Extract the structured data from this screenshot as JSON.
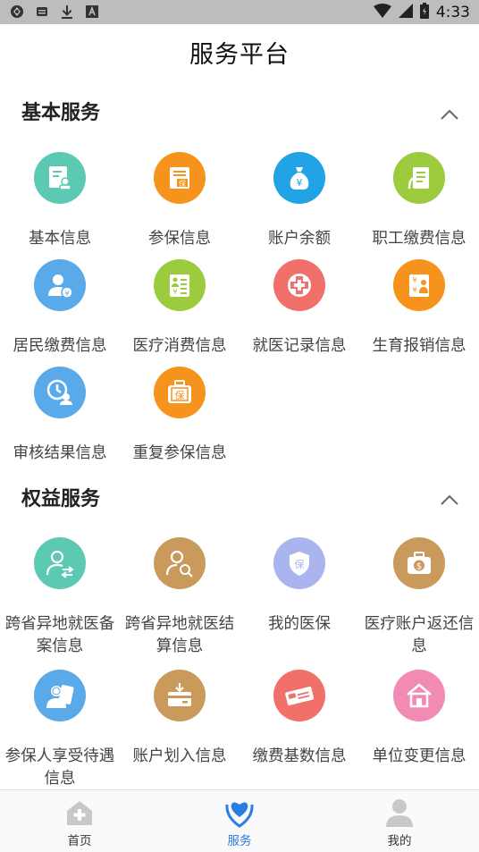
{
  "status_bar": {
    "time": "4:33"
  },
  "header": {
    "title": "服务平台"
  },
  "sections": [
    {
      "title": "基本服务",
      "items": [
        {
          "label": "基本信息",
          "icon": "id-card-icon",
          "color": "#5cc9b3"
        },
        {
          "label": "参保信息",
          "icon": "insurance-doc-icon",
          "color": "#f6931d"
        },
        {
          "label": "账户余额",
          "icon": "money-bag-icon",
          "color": "#22a3e6"
        },
        {
          "label": "职工缴费信息",
          "icon": "document-pen-icon",
          "color": "#9ccb3e"
        },
        {
          "label": "居民缴费信息",
          "icon": "user-yuan-icon",
          "color": "#5aa9e9"
        },
        {
          "label": "医疗消费信息",
          "icon": "medical-bill-icon",
          "color": "#9ccb3e"
        },
        {
          "label": "就医记录信息",
          "icon": "medical-cross-icon",
          "color": "#f1706a"
        },
        {
          "label": "生育报销信息",
          "icon": "maternity-bill-icon",
          "color": "#f6931d"
        },
        {
          "label": "审核结果信息",
          "icon": "review-clock-icon",
          "color": "#5aa9e9"
        },
        {
          "label": "重复参保信息",
          "icon": "briefcase-bao-icon",
          "color": "#f6931d"
        }
      ]
    },
    {
      "title": "权益服务",
      "items": [
        {
          "label": "跨省异地就医备案信息",
          "icon": "user-transfer-icon",
          "color": "#5cc9b3"
        },
        {
          "label": "跨省异地就医结算信息",
          "icon": "user-search-icon",
          "color": "#c99a5b"
        },
        {
          "label": "我的医保",
          "icon": "shield-bao-icon",
          "color": "#aab4ef"
        },
        {
          "label": "医疗账户返还信息",
          "icon": "dollar-wallet-icon",
          "color": "#c99a5b"
        },
        {
          "label": "参保人享受待遇信息",
          "icon": "person-card-icon",
          "color": "#5aa9e9"
        },
        {
          "label": "账户划入信息",
          "icon": "card-transfer-icon",
          "color": "#c99a5b"
        },
        {
          "label": "缴费基数信息",
          "icon": "ticket-icon",
          "color": "#f1706a"
        },
        {
          "label": "单位变更信息",
          "icon": "house-icon",
          "color": "#f28bb3"
        }
      ]
    }
  ],
  "tabs": [
    {
      "label": "首页",
      "icon": "home-plus-icon",
      "active": false
    },
    {
      "label": "服务",
      "icon": "heart-hands-icon",
      "active": true
    },
    {
      "label": "我的",
      "icon": "person-icon",
      "active": false
    }
  ],
  "colors": {
    "active_tab": "#2a7de1",
    "inactive_icon": "#c8c8c8"
  }
}
